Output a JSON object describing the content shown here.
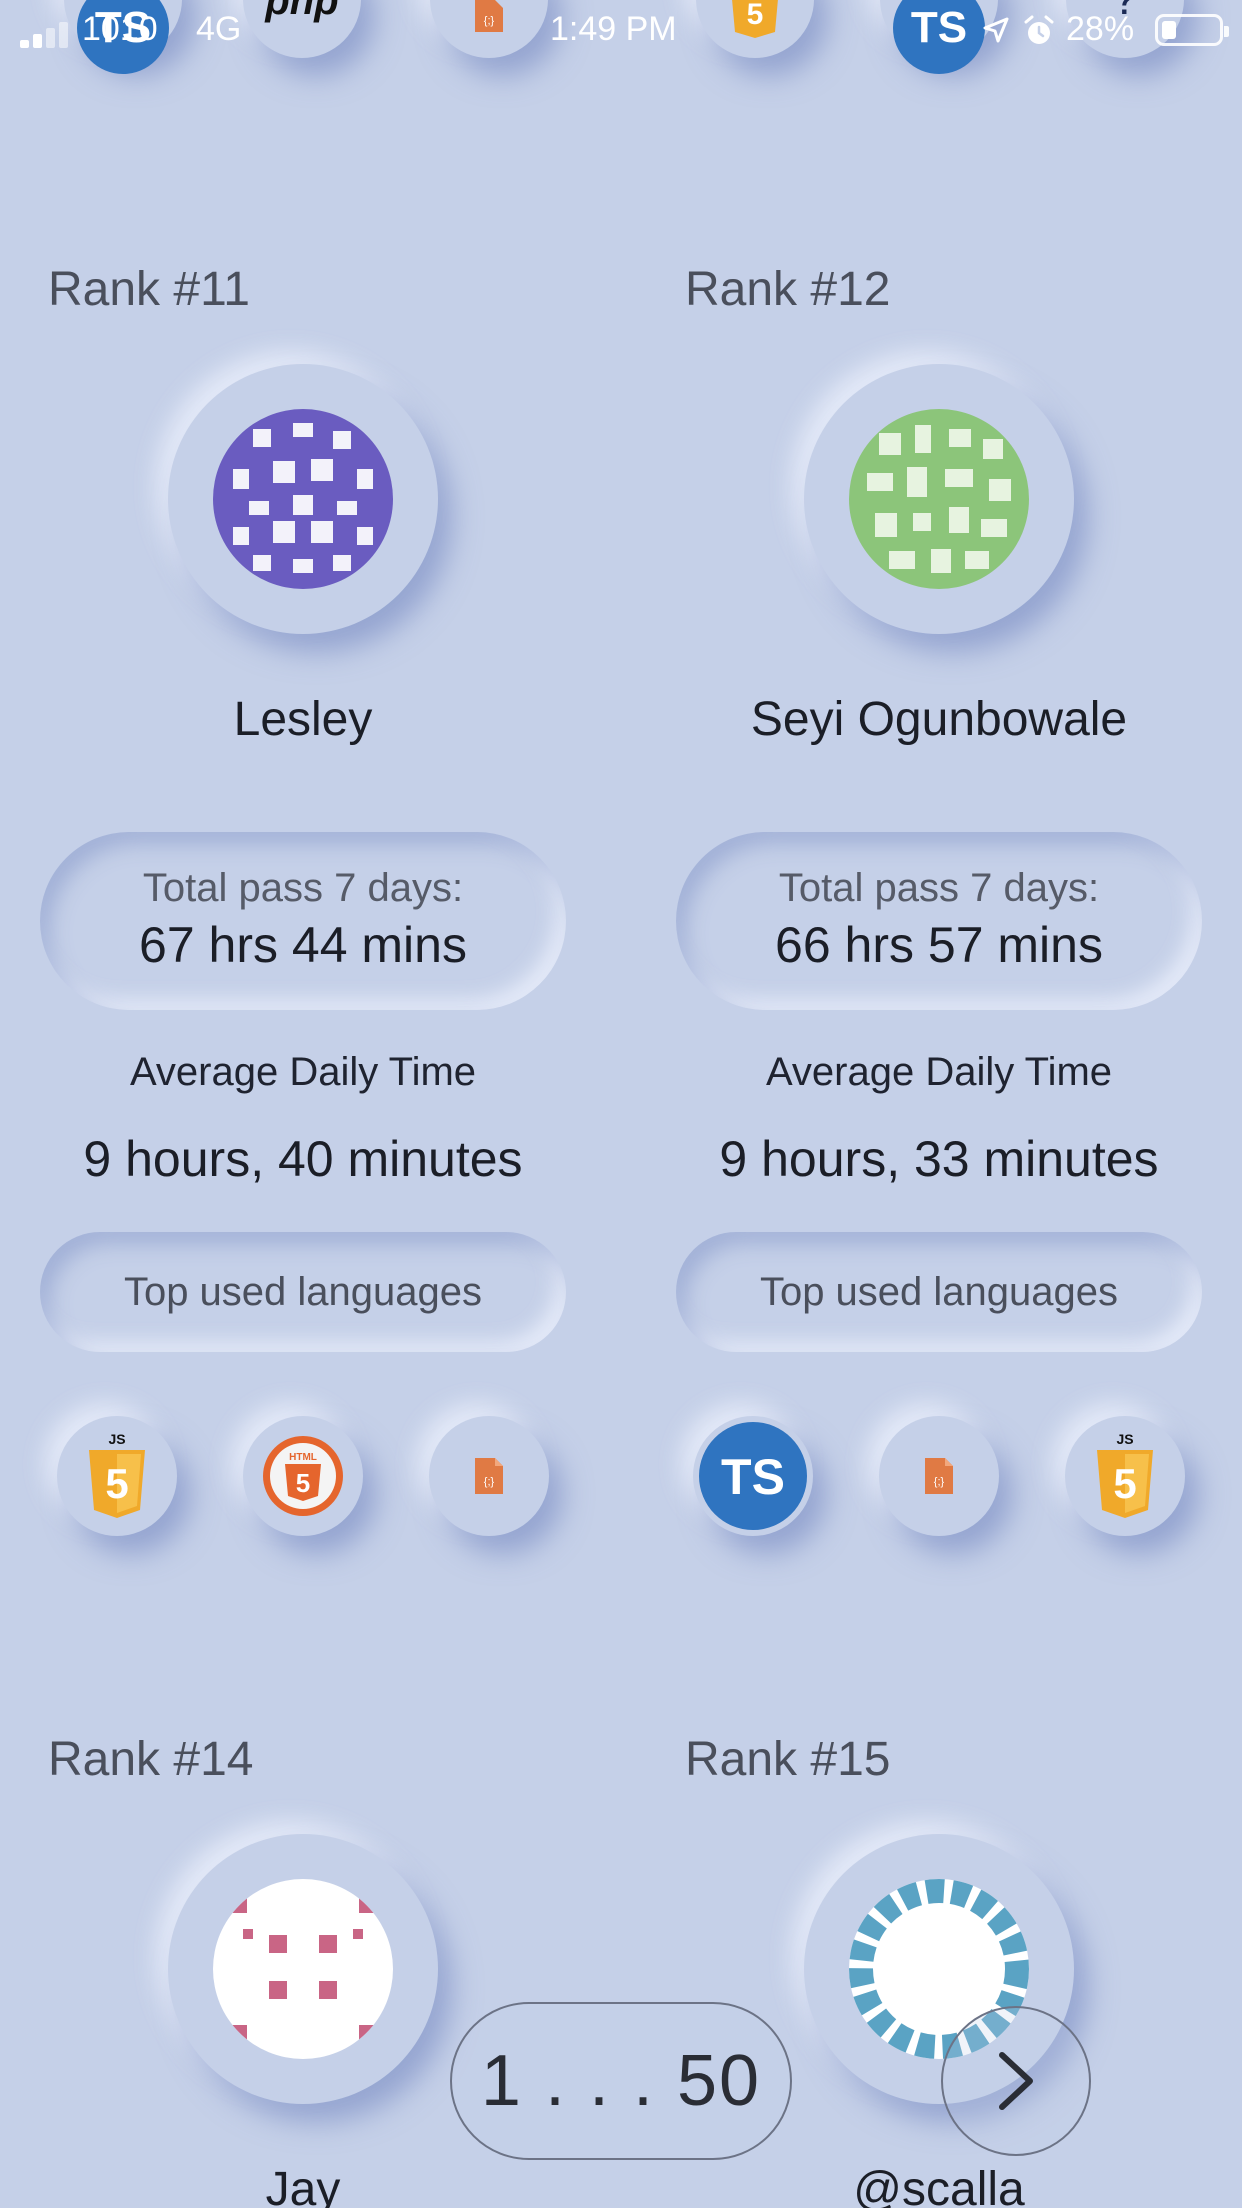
{
  "status_bar": {
    "carrier": "1010",
    "network": "4G",
    "time": "1:49 PM",
    "battery": "28%"
  },
  "cards": [
    {
      "rank": "Rank #11",
      "name": "Lesley",
      "total_label": "Total pass 7 days:",
      "total_value": "67 hrs 44 mins",
      "avg_label": "Average Daily Time",
      "avg_value": "9 hours, 40 minutes",
      "top_languages_label": "Top used languages",
      "languages": [
        "javascript-icon",
        "html5-icon",
        "json-file-icon"
      ]
    },
    {
      "rank": "Rank #12",
      "name": "Seyi Ogunbowale",
      "total_label": "Total pass 7 days:",
      "total_value": "66 hrs 57 mins",
      "avg_label": "Average Daily Time",
      "avg_value": "9 hours, 33 minutes",
      "top_languages_label": "Top used languages",
      "languages": [
        "typescript-icon",
        "json-file-icon",
        "javascript-icon"
      ]
    },
    {
      "rank": "Rank #14",
      "name": "Jay"
    },
    {
      "rank": "Rank #15",
      "name": "@scalla"
    }
  ],
  "icon_text": {
    "js": "JS",
    "html": "HTML",
    "ts": "TS",
    "php": "php",
    "json": "{;}",
    "unknown": "?"
  },
  "pagination": {
    "label": "1 . . . 50"
  },
  "colors": {
    "background": "#c5d0e8",
    "js": "#f0a92a",
    "html": "#e5652d",
    "ts": "#2f74c0",
    "json": "#e07a44"
  }
}
